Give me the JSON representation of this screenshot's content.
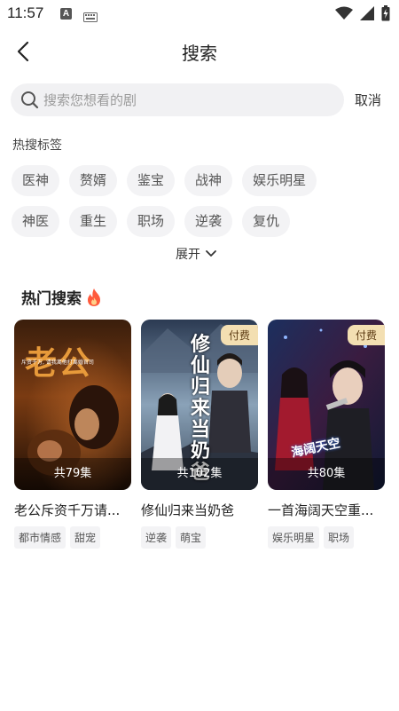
{
  "status_bar": {
    "time": "11:57",
    "notif_letter": "A"
  },
  "header": {
    "title": "搜索"
  },
  "search": {
    "placeholder": "搜索您想看的剧",
    "cancel_label": "取消"
  },
  "hot_tags": {
    "label": "热搜标签",
    "row1": [
      "医神",
      "赘婿",
      "鉴宝",
      "战神",
      "娱乐明星"
    ],
    "row2": [
      "神医",
      "重生",
      "职场",
      "逆袭",
      "复仇"
    ],
    "expand_label": "展开"
  },
  "hot_search": {
    "title": "热门搜索",
    "cards": [
      {
        "title": "老公斥资千万请...",
        "episodes": "共79集",
        "paid": "",
        "genres": [
          "都市情感",
          "甜宠"
        ],
        "poster_text": "老公",
        "poster_sub": "斥资千万, 请我离他打离婚官司"
      },
      {
        "title": "修仙归来当奶爸",
        "episodes": "共102集",
        "paid": "付费",
        "genres": [
          "逆袭",
          "萌宝"
        ],
        "poster_text": "修仙归来当奶爸",
        "poster_sub": ""
      },
      {
        "title": "一首海阔天空重...",
        "episodes": "共80集",
        "paid": "付费",
        "genres": [
          "娱乐明星",
          "职场"
        ],
        "poster_text": "海阔天空",
        "poster_sub": ""
      }
    ]
  },
  "colors": {
    "tag_bg": "#f3f3f5",
    "paid_badge": "#f3dfb2",
    "fire": "#ff5a3c"
  }
}
